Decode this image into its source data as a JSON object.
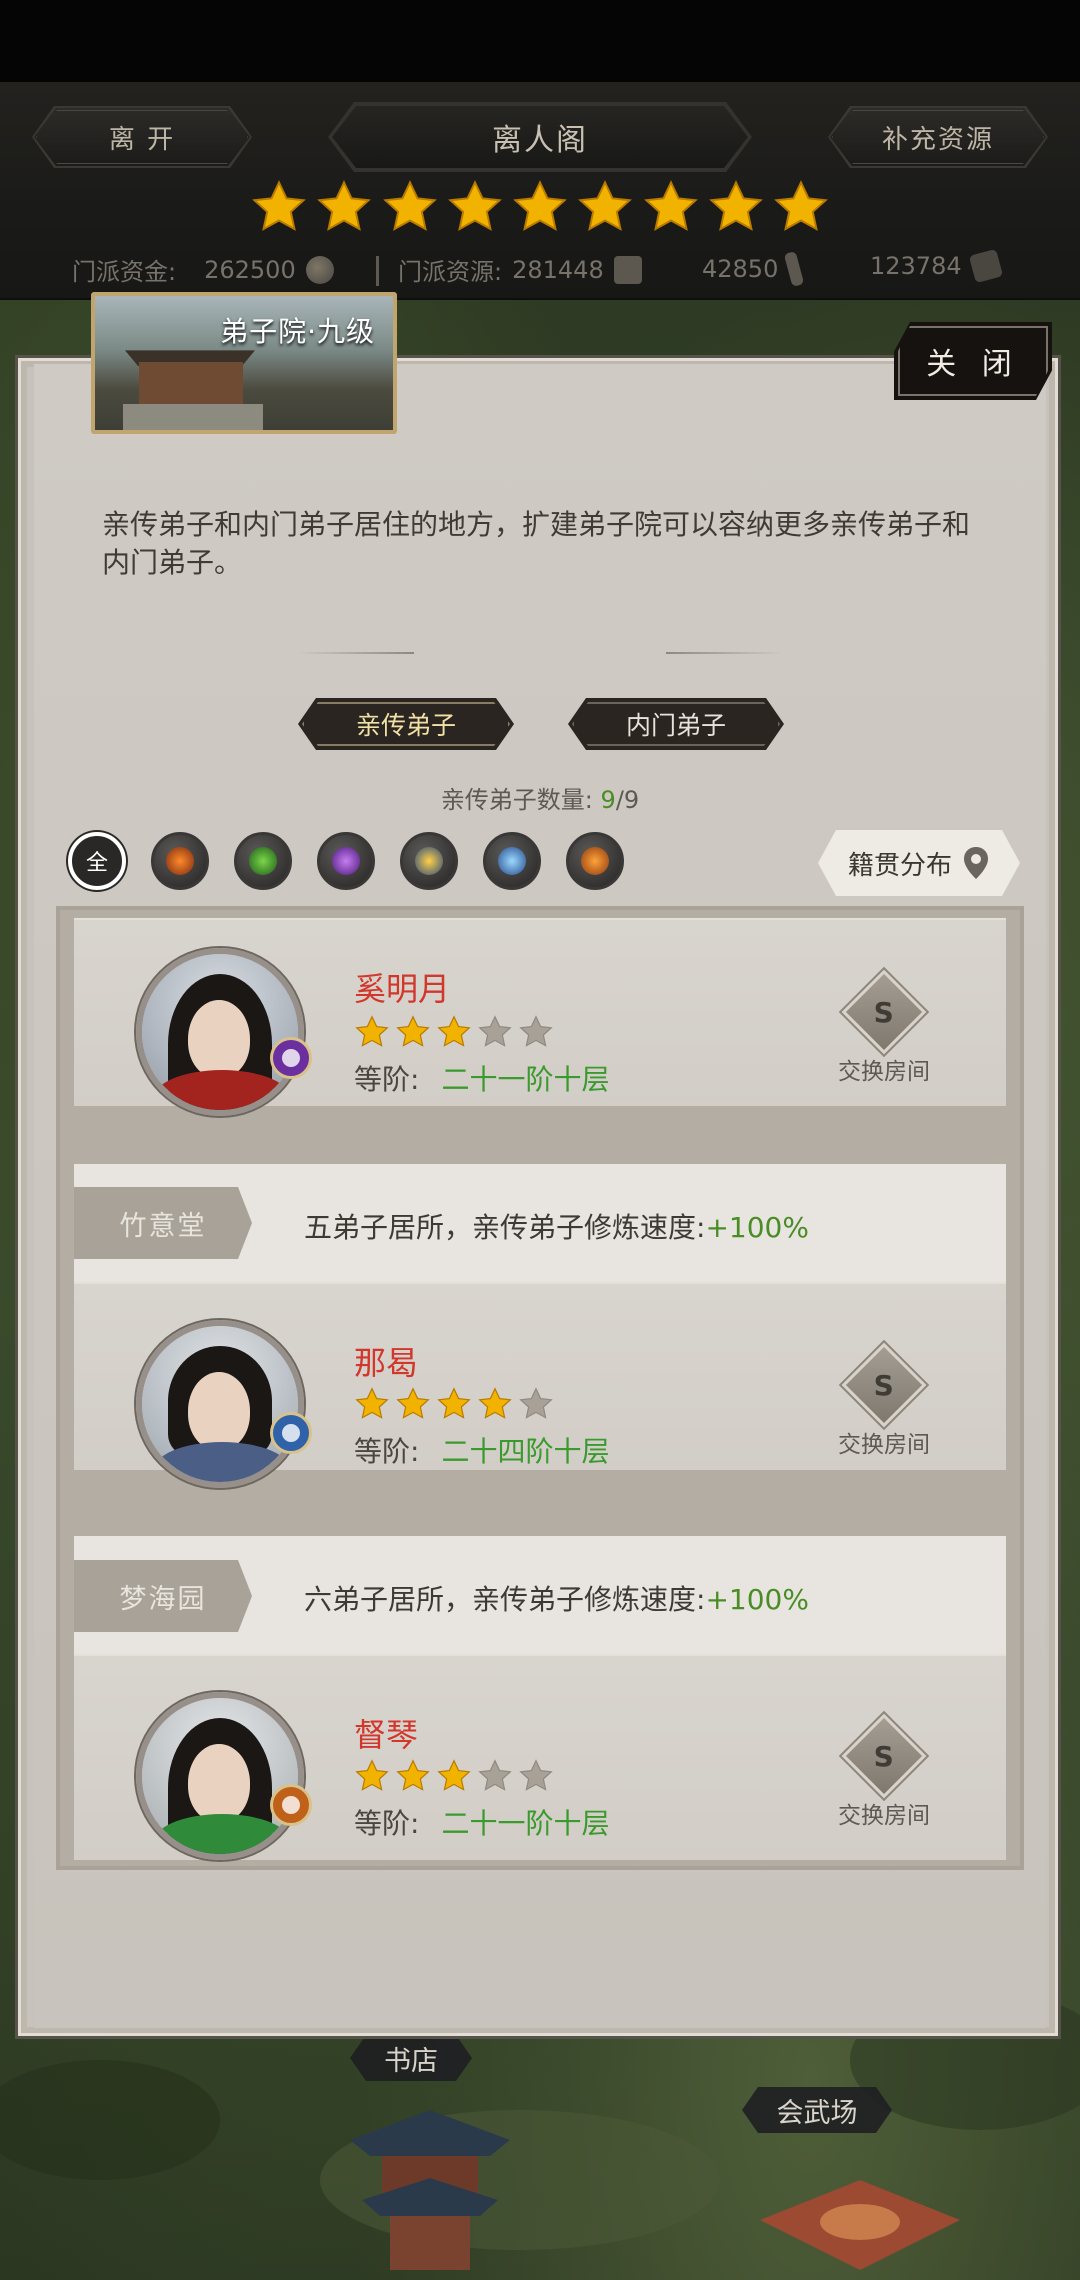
{
  "header": {
    "leave_label": "离 开",
    "title": "离人阁",
    "replenish_label": "补充资源",
    "sect_stars": 9,
    "resources": {
      "funds_label": "门派资金:",
      "funds_value": "262500",
      "resources_label": "门派资源:",
      "resources_value": "281448",
      "res3_value": "42850",
      "res4_value": "123784"
    }
  },
  "panel": {
    "building_title": "弟子院·九级",
    "close_label": "关 闭",
    "description": "亲传弟子和内门弟子居住的地方，扩建弟子院可以容纳更多亲传弟子和内门弟子。",
    "tabs": [
      {
        "label": "亲传弟子",
        "active": true
      },
      {
        "label": "内门弟子",
        "active": false
      }
    ],
    "count_label": "亲传弟子数量:",
    "count_current": "9",
    "count_total": "/9",
    "filter_all_label": "全",
    "filters": [
      "fire-sword-icon",
      "wind-blade-icon",
      "poison-staff-icon",
      "thunder-mace-icon",
      "ice-sword-icon",
      "fire-orb-icon"
    ],
    "origin_label": "籍贯分布",
    "swap_label": "交换房间",
    "rank_label": "等阶:",
    "disciples": [
      {
        "name": "奚明月",
        "stars": 3,
        "max_stars": 5,
        "rank": "二十一阶十层",
        "element_color": "#6b2fa0"
      },
      {
        "name": "那曷",
        "stars": 4,
        "max_stars": 5,
        "rank": "二十四阶十层",
        "element_color": "#2f62a8"
      },
      {
        "name": "督琴",
        "stars": 3,
        "max_stars": 5,
        "rank": "二十一阶十层",
        "element_color": "#c0611a"
      }
    ],
    "rooms": [
      {
        "name": "竹意堂",
        "text": "五弟子居所，亲传弟子修炼速度:",
        "bonus": "+100%"
      },
      {
        "name": "梦海园",
        "text": "六弟子居所，亲传弟子修炼速度:",
        "bonus": "+100%"
      }
    ]
  },
  "map": {
    "bookstore_label": "书店",
    "arena_label": "会武场"
  },
  "colors": {
    "accent_gold": "#f2b200",
    "name_red": "#d1372b",
    "value_green": "#3b9a2e"
  }
}
